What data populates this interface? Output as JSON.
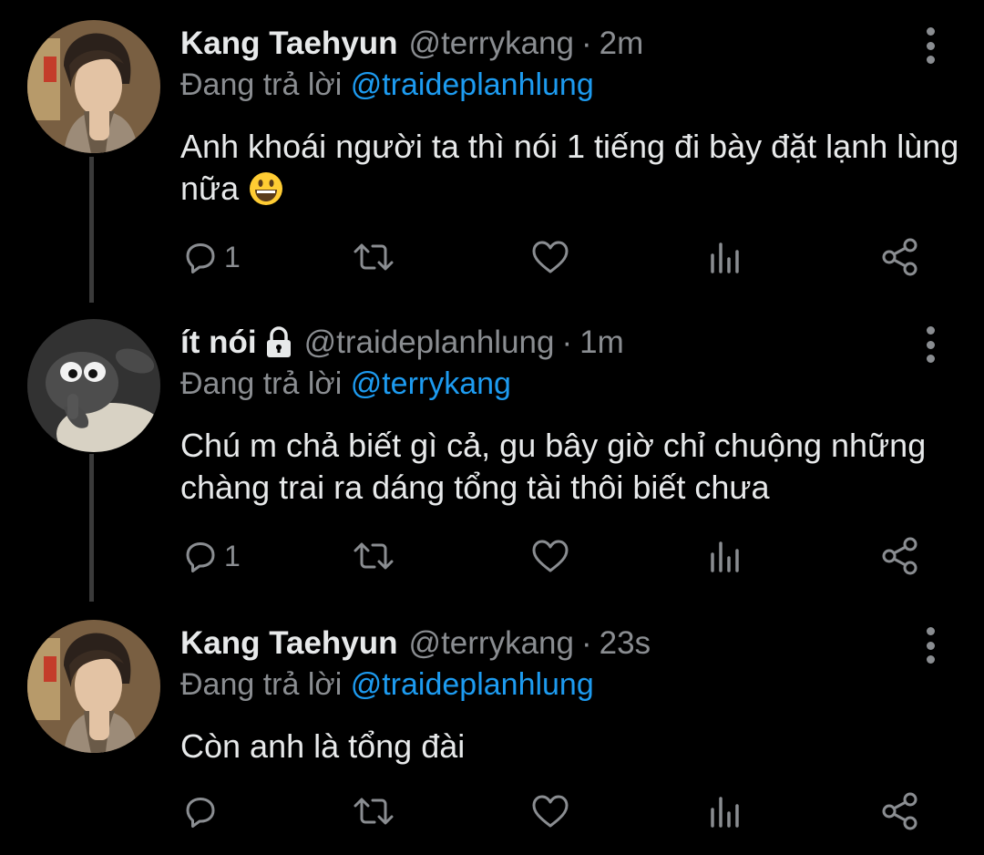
{
  "colors": {
    "background": "#000000",
    "name": "#e7e9ea",
    "muted": "#8a8d91",
    "link": "#1d9bf0",
    "thread_line": "#3a3a3a"
  },
  "tweets": [
    {
      "name": "Kang Taehyun",
      "handle": "@terrykang",
      "separator": "·",
      "time": "2m",
      "reply_prefix": "Đang trả lời",
      "reply_to": "@traideplanhlung",
      "text": "Anh khoái người ta thì nói 1 tiếng đi bày đặt lạnh lùng nữa",
      "emoji_icon": "grinning-face-emoji",
      "reply_count": "1",
      "locked": false
    },
    {
      "name": "ít nói",
      "handle": "@traideplanhlung",
      "separator": "·",
      "time": "1m",
      "reply_prefix": "Đang trả lời",
      "reply_to": "@terrykang",
      "text": "Chú m chả biết gì cả, gu bây giờ chỉ chuộng những chàng trai ra dáng tổng tài thôi biết chưa",
      "reply_count": "1",
      "locked": true,
      "lock_icon": "lock-icon"
    },
    {
      "name": "Kang Taehyun",
      "handle": "@terrykang",
      "separator": "·",
      "time": "23s",
      "reply_prefix": "Đang trả lời",
      "reply_to": "@traideplanhlung",
      "text": "Còn anh là tổng đài",
      "reply_count": "",
      "locked": false
    }
  ],
  "action_icons": [
    "reply-icon",
    "retweet-icon",
    "like-icon",
    "stats-icon",
    "share-icon"
  ]
}
